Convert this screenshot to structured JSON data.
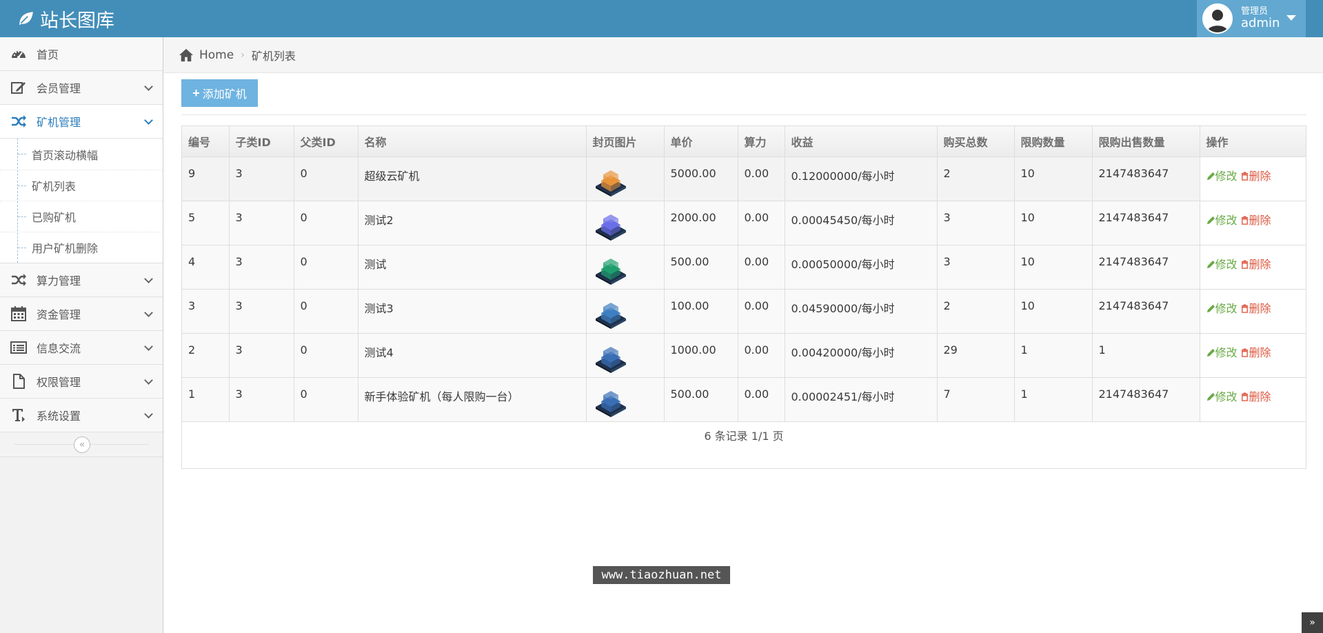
{
  "brand": {
    "title": "站长图库"
  },
  "user": {
    "role": "管理员",
    "name": "admin"
  },
  "sidebar": {
    "items": [
      {
        "label": "首页",
        "icon": "dashboard-icon"
      },
      {
        "label": "会员管理",
        "icon": "edit-icon"
      },
      {
        "label": "矿机管理",
        "icon": "shuffle-icon"
      },
      {
        "label": "算力管理",
        "icon": "shuffle-icon"
      },
      {
        "label": "资金管理",
        "icon": "calendar-icon"
      },
      {
        "label": "信息交流",
        "icon": "list-icon"
      },
      {
        "label": "权限管理",
        "icon": "file-icon"
      },
      {
        "label": "系统设置",
        "icon": "text-icon"
      }
    ],
    "submenu": [
      "首页滚动横幅",
      "矿机列表",
      "已购矿机",
      "用户矿机删除"
    ],
    "active_color": "#2b7dbc"
  },
  "breadcrumb": {
    "home": "Home",
    "current": "矿机列表"
  },
  "toolbar": {
    "add_label": "添加矿机"
  },
  "table": {
    "headers": [
      "编号",
      "子类ID",
      "父类ID",
      "名称",
      "封页图片",
      "单价",
      "算力",
      "收益",
      "购买总数",
      "限购数量",
      "限购出售数量",
      "操作"
    ],
    "rows": [
      {
        "id": "9",
        "sub": "3",
        "parent": "0",
        "name": "超级云矿机",
        "cover": "#e8943a",
        "price": "5000.00",
        "power": "0.00",
        "income": "0.12000000/每小时",
        "total": "2",
        "limit": "10",
        "sale_limit": "2147483647"
      },
      {
        "id": "5",
        "sub": "3",
        "parent": "0",
        "name": "测试2",
        "cover": "#6a6ee8",
        "price": "2000.00",
        "power": "0.00",
        "income": "0.00045450/每小时",
        "total": "3",
        "limit": "10",
        "sale_limit": "2147483647"
      },
      {
        "id": "4",
        "sub": "3",
        "parent": "0",
        "name": "测试",
        "cover": "#1f9e6e",
        "price": "500.00",
        "power": "0.00",
        "income": "0.00050000/每小时",
        "total": "3",
        "limit": "10",
        "sale_limit": "2147483647"
      },
      {
        "id": "3",
        "sub": "3",
        "parent": "0",
        "name": "测试3",
        "cover": "#3f7fc0",
        "price": "100.00",
        "power": "0.00",
        "income": "0.04590000/每小时",
        "total": "2",
        "limit": "10",
        "sale_limit": "2147483647"
      },
      {
        "id": "2",
        "sub": "3",
        "parent": "0",
        "name": "测试4",
        "cover": "#3a6fb5",
        "price": "1000.00",
        "power": "0.00",
        "income": "0.00420000/每小时",
        "total": "29",
        "limit": "1",
        "sale_limit": "1"
      },
      {
        "id": "1",
        "sub": "3",
        "parent": "0",
        "name": "新手体验矿机（每人限购一台）",
        "cover": "#3a6fb5",
        "price": "500.00",
        "power": "0.00",
        "income": "0.00002451/每小时",
        "total": "7",
        "limit": "1",
        "sale_limit": "2147483647"
      }
    ],
    "edit_label": "修改",
    "delete_label": "删除"
  },
  "pager": {
    "text": "6 条记录 1/1 页"
  },
  "watermark": "www.tiaozhuan.net",
  "colors": {
    "navbar": "#438eb9",
    "edit": "#69aa46",
    "delete": "#dd5a43",
    "button": "#6fb3e0"
  }
}
